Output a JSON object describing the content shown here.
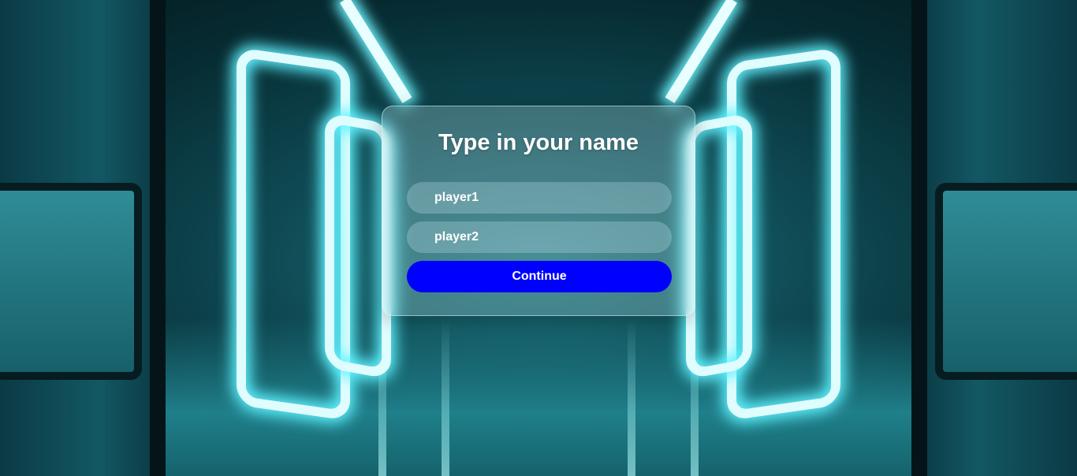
{
  "dialog": {
    "title": "Type in your name",
    "player1_placeholder": "player1",
    "player2_placeholder": "player2",
    "continue_label": "Continue"
  },
  "colors": {
    "button_bg": "#0000ff",
    "text": "#ffffff",
    "neon": "#5ff3ff"
  }
}
